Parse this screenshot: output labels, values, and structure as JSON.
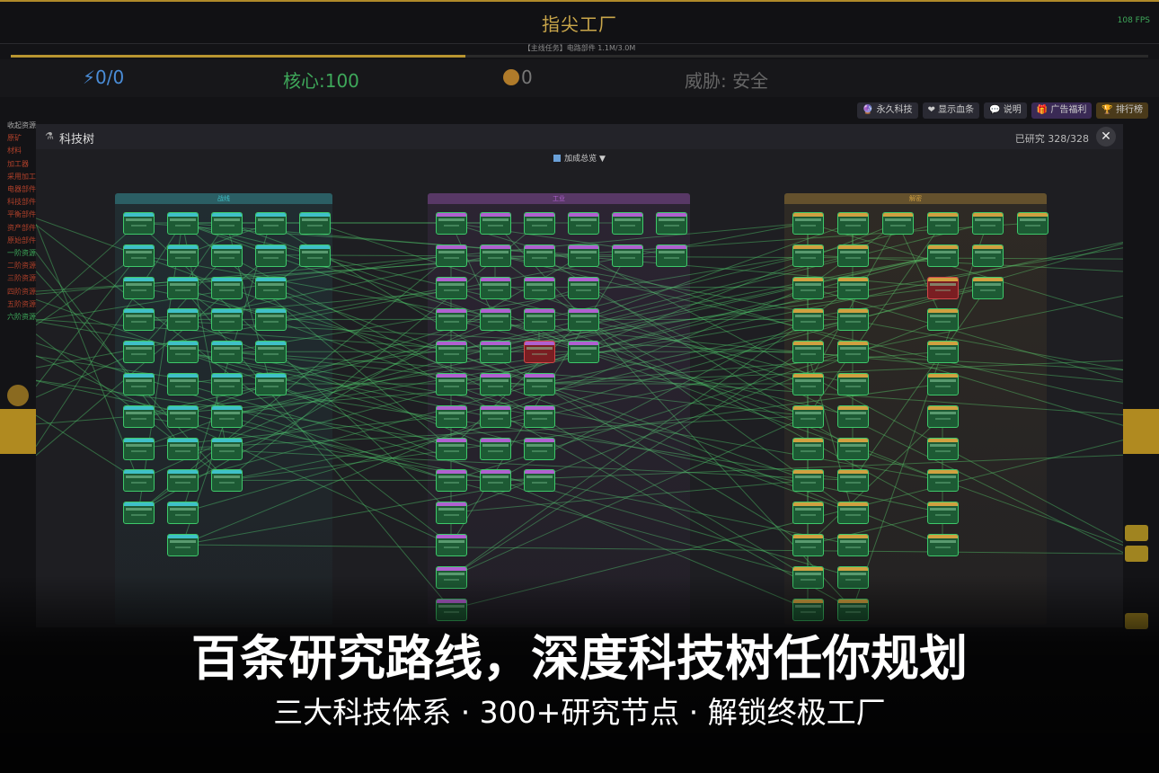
{
  "app": {
    "title": "指尖工厂",
    "fps": "108 FPS"
  },
  "mission": {
    "text": "【主线任务】电路部件 1.1M/3.0M",
    "progress": 0.4
  },
  "stats": {
    "energy": "⚡0/0",
    "core": "核心:100",
    "radiation": "0",
    "threat": "威胁:  安全"
  },
  "top_buttons": [
    "🔮 永久科技",
    "❤ 显示血条",
    "💬 说明",
    "🎁 广告福利",
    "🏆 排行榜"
  ],
  "left_list": [
    "收起资源",
    "原矿",
    "材料",
    "加工器",
    "采用加工",
    "电器部件",
    "科技部件",
    "平衡部件",
    "资产部件",
    "原始部件",
    "一阶资源",
    "二阶资源",
    "三阶资源",
    "四阶资源",
    "五阶资源",
    "六阶资源"
  ],
  "tech_panel": {
    "title": "科技树",
    "researched": "已研究 328/328",
    "close": "✕",
    "bonus_summary": "加成总览 ▼",
    "columns": [
      {
        "name": "战线",
        "color": "#3fc0c8"
      },
      {
        "name": "工业",
        "color": "#b060d0"
      },
      {
        "name": "解密",
        "color": "#d0a040"
      }
    ]
  },
  "promo": {
    "headline": "百条研究路线，深度科技树任你规划",
    "subline": "三大科技体系 · 300+研究节点 · 解锁终极工厂"
  }
}
